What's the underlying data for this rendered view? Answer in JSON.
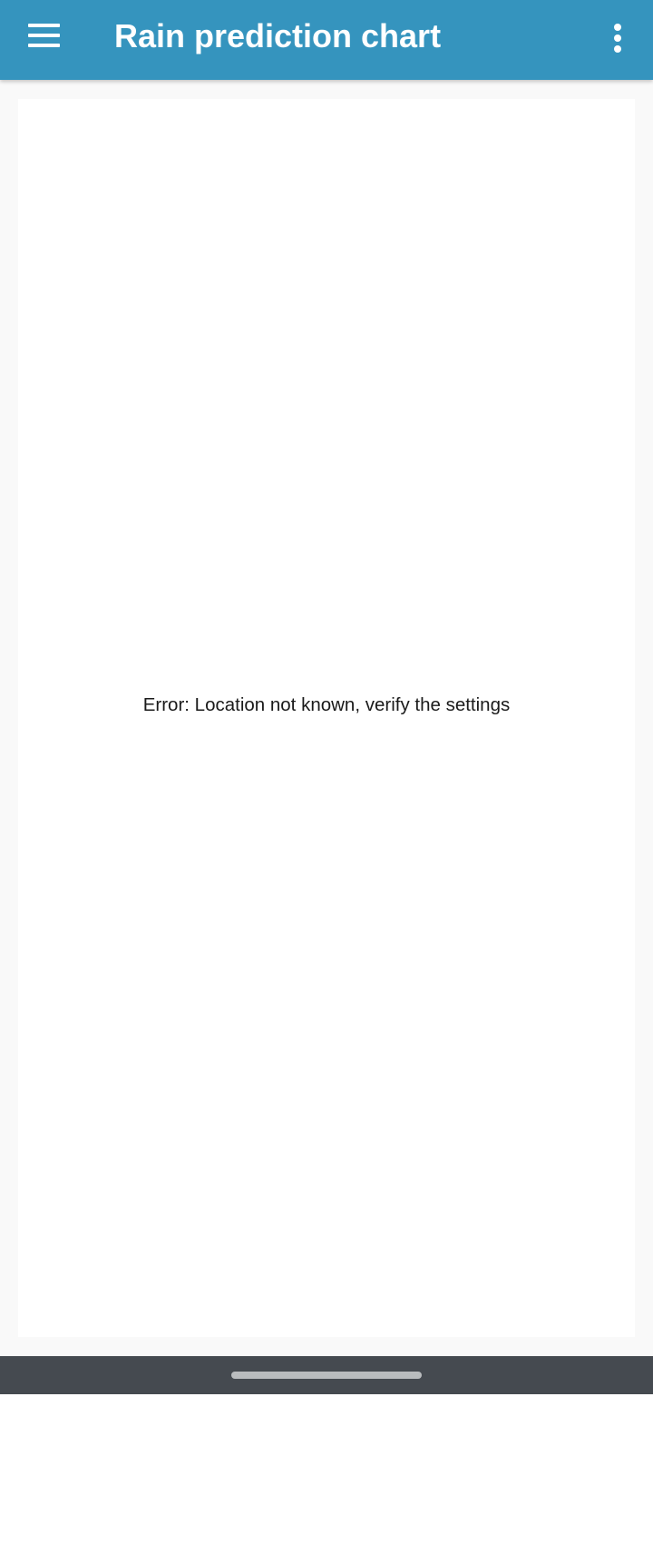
{
  "toolbar": {
    "title": "Rain prediction chart",
    "menu_icon": "hamburger-menu-icon",
    "overflow_icon": "more-vertical-icon",
    "color": "#3594be"
  },
  "content": {
    "message": "Error: Location not known, verify the settings"
  },
  "system_nav": {
    "handle": "home-gesture-handle",
    "color": "#454a50"
  }
}
